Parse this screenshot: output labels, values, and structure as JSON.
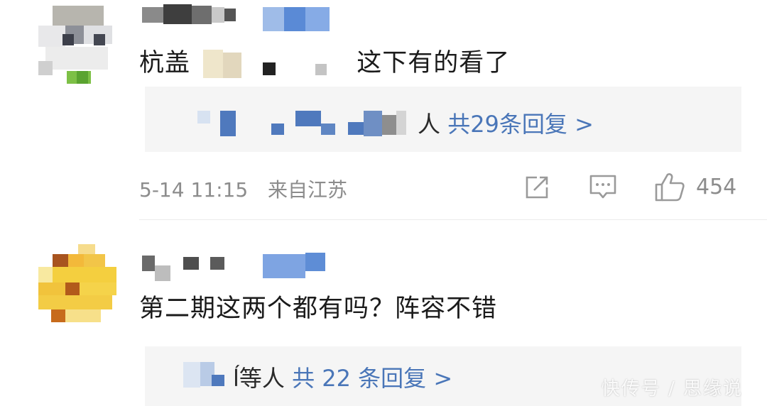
{
  "comments": [
    {
      "text_before": "杭盖",
      "text_after": "这下有的看了",
      "replies": {
        "tail": "人 ",
        "link": "共29条回复 >"
      },
      "meta": {
        "date": "5-14 11:15",
        "location": "来自江苏"
      },
      "likes": "454",
      "icons": [
        "share-icon",
        "comment-icon",
        "like-icon"
      ]
    },
    {
      "text": "第二期这两个都有吗？阵容不错",
      "replies": {
        "tail": "ĺ等人 ",
        "link": "共 22 条回复 >"
      }
    }
  ],
  "watermark": "快传号 / 思缘说",
  "colors": {
    "link": "#4a76b8",
    "meta": "#8c8c8c",
    "reply_bg": "#f5f5f5"
  }
}
